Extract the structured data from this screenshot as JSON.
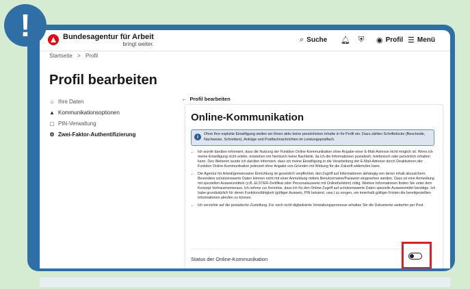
{
  "alert_badge": "!",
  "header": {
    "brand_name": "Bundesagentur für Arbeit",
    "brand_claim": "bringt weiter.",
    "search_label": "Suche",
    "profile_label": "Profil",
    "menu_label": "Menü"
  },
  "breadcrumb": {
    "home": "Startseite",
    "separator": ">",
    "current": "Profil"
  },
  "page_title": "Profil bearbeiten",
  "sidenav": {
    "items": [
      {
        "label": "Ihre Daten"
      },
      {
        "label": "Kommunikationsoptionen"
      },
      {
        "label": "PIN-Verwaltung"
      },
      {
        "label": "Zwei-Faktor-Authentifizierung"
      }
    ]
  },
  "back_link": "Profil bearbeiten",
  "panel": {
    "title": "Online-Kommunikation",
    "info_text": "Ohne Ihre explizite Einwilligung stellen wir Ihnen aktiv keine persönlichen Inhalte in Ihr Profil ein. Dazu zählen Schriftstücke (Bescheide, Nachweise, Schreiben), Anträge und Postfachnachrichten im Leistungspostfach.",
    "bullets": [
      "Ich wurde darüber informiert, dass die Nutzung der Funktion Online-Kommunikation ohne Angabe einer E-Mail-Adresse nicht möglich ist. Wenn ich meine Einwilligung nicht erteile, entstehen mir hierdurch keine Nachteile, da ich die Informationen postalisch, telefonisch oder persönlich erhalten kann. Des Weiteren wurde ich darüber informiert, dass ich meine Einwilligung in die Verarbeitung der E-Mail-Adresse durch Deaktivieren der Funktion Online-Kommunikation jederzeit ohne Angabe von Gründen mit Wirkung für die Zukunft widerrufen kann.",
      "Die Agentur für Arbeit/gemeinsame Einrichtung ist gesetzlich verpflichtet, den Zugriff auf Informationen abhängig von deren Inhalt abzusichern. Besonders schützenswerte Daten können nicht mit einer Anmeldung mittels Benutzername/Passwort eingesehen werden. Dazu ist eine Anmeldung mit speziellen Ausweismitteln (z.B. ELSTER-Zertifikat oder Personalausweis mit Onlinefunktion) nötig. Weitere Informationen finden Sie unter dem Konzept Vertrauensniveaus. Ich nehme zur Kenntnis, dass ich für den Online-Zugriff auf schützenswerte Daten spezielle Ausweismittel benötige. Ich habe grundsätzlich für deren Funktionsfähigkeit (gültiger Ausweis, PIN bekannt, usw.) zu sorgen, um innerhalb gültiger Fristen die bereitgestellten Informationen abrufen zu können.",
      "Ich verzichte auf die postalische Zustellung. Für noch nicht digitalisierte Verwaltungsprozesse erhalten Sie die Dokumente weiterhin per Post."
    ],
    "status_label": "Status der Online-Kommunikation",
    "toggle_state": "off"
  },
  "colors": {
    "frame_blue": "#2f6fa6",
    "brand_red": "#e30613",
    "highlight_red": "#d3222a",
    "info_bg": "#dde6f0"
  },
  "icons": [
    "search-icon",
    "bell-icon",
    "shield-icon",
    "user-circle-icon",
    "hamburger-icon",
    "person-icon",
    "bell-icon",
    "lock-icon",
    "gear-icon",
    "arrow-left-icon",
    "info-icon"
  ]
}
